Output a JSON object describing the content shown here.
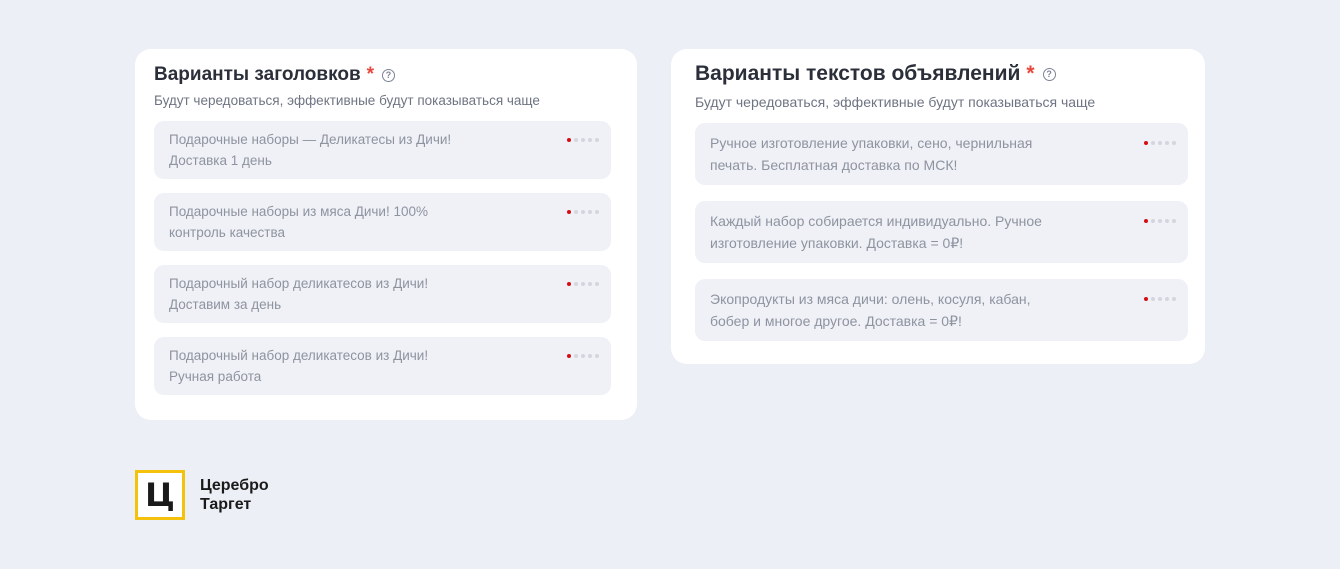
{
  "headlines": {
    "title": "Варианты заголовков",
    "required_mark": "*",
    "help_glyph": "?",
    "subtitle": "Будут чередоваться, эффективные будут показываться чаще",
    "items": [
      {
        "text": "Подарочные наборы — Деликатесы из Дичи! Доставка 1 день",
        "rating": 1,
        "rating_max": 5
      },
      {
        "text": "Подарочные наборы из мяса Дичи! 100% контроль качества",
        "rating": 1,
        "rating_max": 5
      },
      {
        "text": "Подарочный набор деликатесов из Дичи! Доставим за день",
        "rating": 1,
        "rating_max": 5
      },
      {
        "text": "Подарочный набор деликатесов из Дичи! Ручная работа",
        "rating": 1,
        "rating_max": 5
      }
    ]
  },
  "texts": {
    "title": "Варианты текстов объявлений",
    "required_mark": "*",
    "help_glyph": "?",
    "subtitle": "Будут чередоваться, эффективные будут показываться чаще",
    "items": [
      {
        "text": "Ручное изготовление упаковки, сено, чернильная печать. Бесплатная доставка по МСК!",
        "rating": 1,
        "rating_max": 5
      },
      {
        "text": "Каждый набор собирается индивидуально. Ручное изготовление упаковки. Доставка = 0₽!",
        "rating": 1,
        "rating_max": 5
      },
      {
        "text": "Экопродукты из мяса дичи: олень, косуля, кабан, бобер и многое другое. Доставка = 0₽!",
        "rating": 1,
        "rating_max": 5
      }
    ]
  },
  "logo": {
    "mark": "Ц",
    "line1": "Церебро",
    "line2": "Таргет"
  },
  "colors": {
    "accent_yellow": "#f4c20d",
    "rating_on": "#d40f14",
    "rating_off": "#d3d6de",
    "required_star": "#e8473b"
  }
}
